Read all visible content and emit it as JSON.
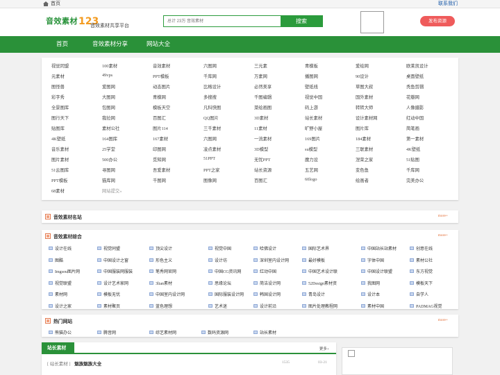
{
  "topbar": {
    "home": "首页",
    "contact": "联系我们"
  },
  "header": {
    "logo_cn": "音效素材",
    "logo_num": "123",
    "slogan": "音效素材共享平台",
    "search_placeholder": "总计 23万 音效素材",
    "search_button": "搜索",
    "publish": "发布资源"
  },
  "nav": [
    "首页",
    "音效素材分享",
    "网站大全"
  ],
  "link_grid": [
    [
      "视觉同盟",
      "100素材",
      "音效素材",
      "六图网",
      "三元素",
      "青模板",
      "爱绘网",
      "欧莱凯设计"
    ],
    [
      "元素材",
      "49vps",
      "PPT模板",
      "千库网",
      "万素网",
      "播图网",
      "90设计",
      "桌面壁纸"
    ],
    [
      "图怪兽",
      "爱图网",
      "动态图片",
      "比格设计",
      "必然美享",
      "壁纸线",
      "草图大叔",
      "秃鱼剪辑"
    ],
    [
      "彩字秀",
      "大图网",
      "青模网",
      "多搜搜",
      "千图编辑",
      "视觉中国",
      "国外素材",
      "花瓣网"
    ],
    [
      "全景图库",
      "包图网",
      "模板天空",
      "凡科快图",
      "菜绘画图",
      "码上游",
      "转转大师",
      "人像摄影"
    ],
    [
      "图行天下",
      "我拉网",
      "百图汇",
      "QQ图片",
      "3D素材",
      "站长素材",
      "设计素材网",
      "红动中国"
    ],
    [
      "贴图库",
      "素材公社",
      "图片114",
      "三千素材",
      "11素材",
      "旷野小屋",
      "图片库",
      "简笔画"
    ],
    [
      "4K壁纸",
      "164图库",
      "167素材",
      "六图网",
      "一流素材",
      "169图片",
      "184素材",
      "第一素材"
    ],
    [
      "音乐素材",
      "25学堂",
      "印图网",
      "凌点素材",
      "3D模型",
      "su模型",
      "三联素材",
      "4K壁纸"
    ],
    [
      "图片素材",
      "500办公",
      "觅知网",
      "51PPT",
      "无忧PPT",
      "魔力设",
      "涅荣之家",
      "51贴图"
    ],
    [
      "51云图库",
      "寻图网",
      "吾爱素材",
      "PPT之家",
      "站长资源",
      "五艺网",
      "变色鱼",
      "千库网"
    ],
    [
      "PPT模板",
      "猫库网",
      "千图网",
      "图像网",
      "百图汇",
      "60logo",
      "绘画者",
      "完美办公"
    ],
    [
      "68素材",
      "网站提交»"
    ]
  ],
  "mingzhan": {
    "title": "音效素材名站",
    "more": "more+"
  },
  "zonghe": {
    "title": "音效素材综合",
    "more": "more+",
    "rows": [
      [
        "设计在线",
        "视觉同盟",
        "顶尖设计",
        "视觉中国",
        "哈佛设计",
        "国际艺术界",
        "中国站长站素材",
        "创意在线"
      ],
      [
        "图酷",
        "中国设计之窗",
        "形色主义",
        "设计坊",
        "深圳室内设计网",
        "最好模板",
        "字体中国",
        "素材公社"
      ],
      [
        "Imgsou图片网",
        "中国服装网服装",
        "笔秀网官网",
        "中国CG资讯网",
        "红动中国",
        "中国艺术设计联",
        "中国设计联盟",
        "东方视觉"
      ],
      [
        "视觉联盟",
        "设计艺术家网",
        "3lian素材",
        "思缘论坛",
        "简洁设计网",
        "52Design素材资",
        "我图网",
        "模板天下"
      ],
      [
        "素材网",
        "模板无忧",
        "中国室内设计网",
        "国际服装设计网",
        "韩国设计网",
        "青岛设计",
        "设计本",
        "自学人"
      ],
      [
        "设计之家",
        "素材聚页",
        "蓝色理想",
        "艺术迷",
        "设计前沿",
        "图片处理教程网",
        "素材中国",
        "PADMAG视觉"
      ]
    ]
  },
  "hot": {
    "title": "热门网站",
    "more": "more+",
    "items": [
      "熊猫办公",
      "腾音网",
      "综艺素材网",
      "数码资源网",
      "站长素材"
    ]
  },
  "zz": {
    "tab": "站长素材",
    "more": "更多+",
    "row": {
      "tag": "[ 站长素材 ]",
      "title": "魅族魅族大全",
      "count": "1535",
      "date": "03-21"
    }
  }
}
